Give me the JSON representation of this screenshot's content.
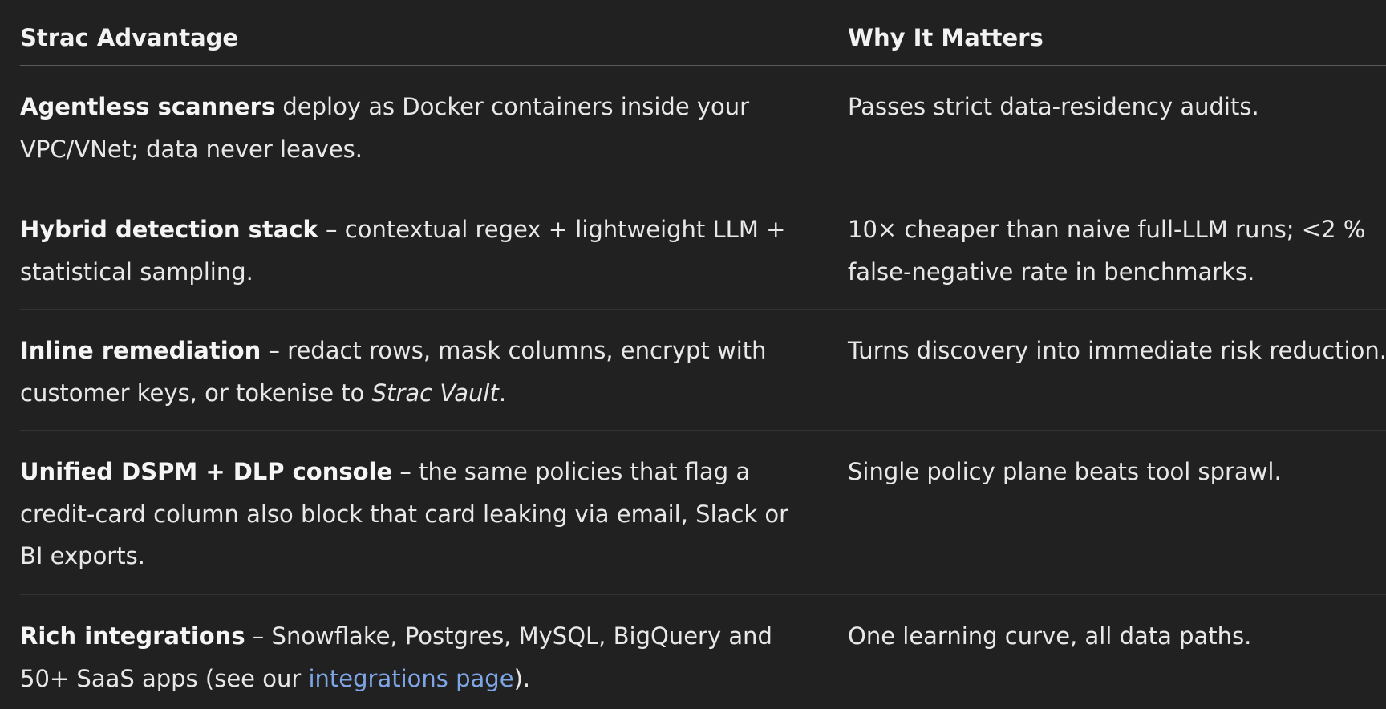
{
  "table": {
    "headers": [
      "Strac Advantage",
      "Why It Matters"
    ],
    "rows": [
      {
        "advantage_bold": "Agentless scanners",
        "advantage_text": " deploy as Docker containers inside your VPC/VNet; data never leaves.",
        "matters": "Passes strict data-residency audits."
      },
      {
        "advantage_bold": "Hybrid detection stack",
        "advantage_text": " – contextual regex + lightweight LLM + statistical sampling.",
        "matters": "10× cheaper than naive full-LLM runs; <2 % false-negative rate in benchmarks."
      },
      {
        "advantage_bold": "Inline remediation",
        "advantage_text": " – redact rows, mask columns, encrypt with customer keys, or tokenise to ",
        "advantage_italic": "Strac Vault",
        "advantage_end": ".",
        "matters": "Turns discovery into immediate risk reduction."
      },
      {
        "advantage_bold": "Unified DSPM + DLP console",
        "advantage_text": " – the same policies that flag a credit-card column also block that card leaking via email, Slack or BI exports.",
        "matters": "Single policy plane beats tool sprawl."
      },
      {
        "advantage_bold": "Rich integrations",
        "advantage_text": " – Snowflake, Postgres, MySQL, BigQuery and 50+ SaaS apps (see our ",
        "advantage_link": "integrations page",
        "advantage_end": ").",
        "matters": "One learning curve, all data paths."
      }
    ]
  },
  "colors": {
    "background": "#212121",
    "text": "#ececec",
    "link": "#7ea6e6",
    "header_rule": "#5a5a5a",
    "row_rule": "#333333"
  }
}
